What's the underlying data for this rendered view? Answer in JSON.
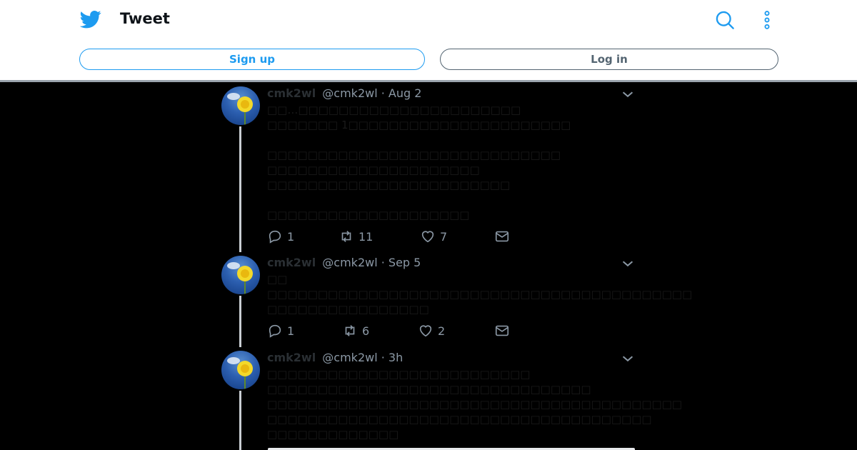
{
  "header": {
    "title": "Tweet",
    "signup_label": "Sign up",
    "login_label": "Log in",
    "icons": [
      "twitter-bird-icon",
      "search-icon",
      "more-vertical-icon"
    ],
    "accent_color": "#1d9bf0"
  },
  "tweets": [
    {
      "name": "cmk2wl",
      "handle": "@cmk2wl",
      "time": "· Aug 2",
      "lines": [
        "□□…□□□□□□□□□□□□□□□□□□□□□□",
        "□□□□□□□ 1□□□□□□□□□□□□□□□□□□□□□□",
        "",
        "□□□□□□□□□□□□□□□□□□□□□□□□□□□□□",
        "□□□□□□□□□□□□□□□□□□□□□",
        "□□□□□□□□□□□□□□□□□□□□□□□□",
        "",
        "□□□□□□□□□□□□□□□□□□□□"
      ],
      "replies": "1",
      "retweets": "11",
      "likes": "7"
    },
    {
      "name": "cmk2wl",
      "handle": "@cmk2wl",
      "time": "· Sep 5",
      "lines": [
        "□□",
        "□□□□□□□□□□□□□□□□□□□□□□□□□□□□□□□□□□□□□□□□□□",
        "□□□□□□□□□□□□□□□□"
      ],
      "replies": "1",
      "retweets": "6",
      "likes": "2"
    },
    {
      "name": "cmk2wl",
      "handle": "@cmk2wl",
      "time": "· 3h",
      "lines": [
        "□□□□□□□□□□□□□□□□□□□□□□□□□□",
        "□□□□□□□□□□□□□□□□□□□□□□□□□□□□□□□□",
        "□□□□□□□□□□□□□□□□□□□□□□□□□□□□□□□□□□□□□□□□□",
        "□□□□□□□□□□□□□□□□□□□□□□□□□□□□□□□□□□□□□□",
        "□□□□□□□□□□□□□"
      ]
    }
  ]
}
